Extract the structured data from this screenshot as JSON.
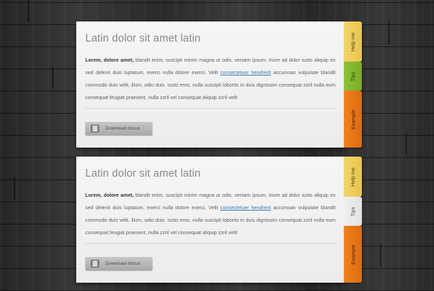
{
  "panels": [
    {
      "title": "Latin dolor sit amet latin",
      "lead": "Lorem, dolore amet,",
      "text_a": " blandit enim, suscipit minim magna ut odio, veniam ipsum. Iriure ad dolor iusto aliquip ex sed delenit duis luptatum, exerci nulla dolore exerci. Velit ",
      "link": "consectetuer hendrerit",
      "text_b": " accumsan vulputate blandit commodo duis velit, illum, odio duis. Iusto eros, nulla suscipit lobortis in duis dignissim consequat zzril nulla eum consequat feugiat praesent, nulla zzril vel consequat aliquip zzril velit",
      "button_label": "Download docus",
      "tabs": {
        "help": "Help me",
        "tips": "Tips",
        "example": "Example"
      },
      "active_tab": "none"
    },
    {
      "title": "Latin dolor sit amet latin",
      "lead": "Lorem, dolore amet,",
      "text_a": " blandit enim, suscipit minim magna ut odio, veniam ipsum. Iriure ad dolor iusto aliquip ex sed delenit duis luptatum, exerci nulla dolore exerci. Velit ",
      "link": "consectetuer hendrerit",
      "text_b": " accumsan vulputate blandit commodo duis velit, illum, odio duis. Iusto eros, nulla suscipit lobortis in duis dignissim consequat zzril nulla eum consequat feugiat praesent, nulla zzril vel consequat aliquip zzril velit",
      "button_label": "Download docus",
      "tabs": {
        "help": "Help me",
        "tips": "Tips",
        "example": "Example"
      },
      "active_tab": "tips"
    }
  ],
  "colors": {
    "tab_help": "#eccc56",
    "tab_tips": "#83b82e",
    "tab_example": "#e8760f",
    "link": "#3a78b4"
  }
}
